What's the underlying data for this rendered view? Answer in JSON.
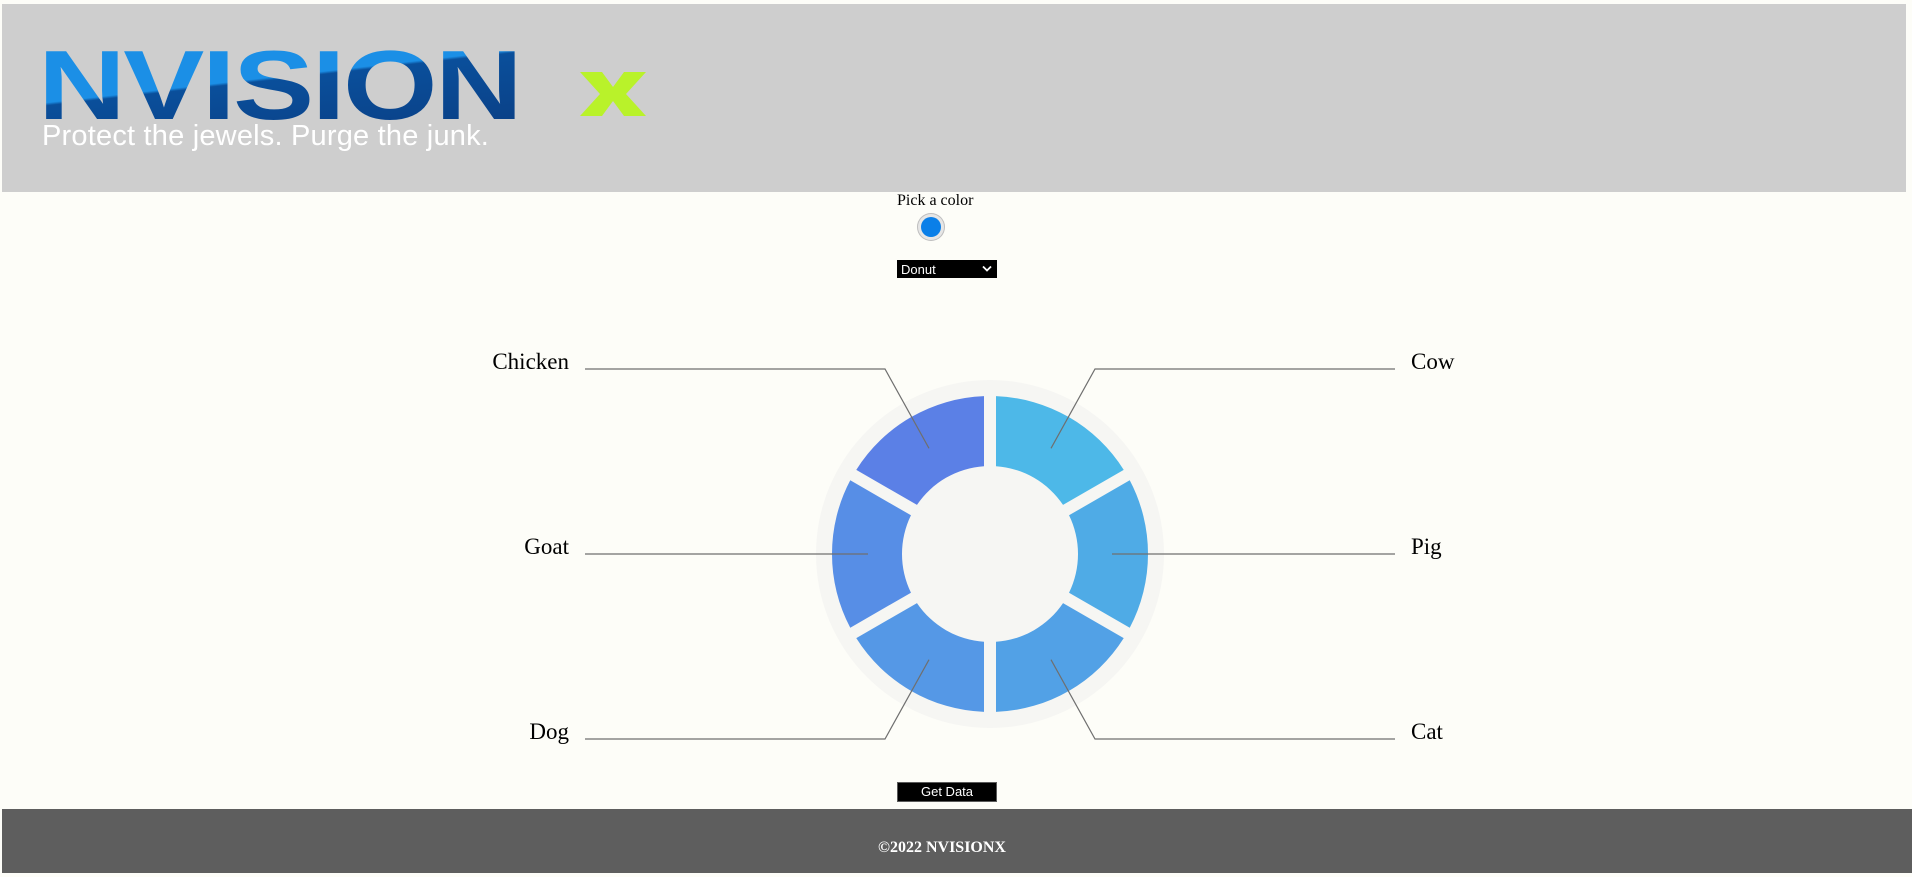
{
  "brand": {
    "logo_text": "NVISION",
    "logo_accent_text": "x",
    "tagline": "Protect the jewels. Purge the junk."
  },
  "controls": {
    "color_label": "Pick a color",
    "color_value": "#0a7fe8",
    "chart_type_selected": "Donut",
    "get_data_label": "Get Data"
  },
  "footer": {
    "copyright": "©2022 NVISIONX"
  },
  "colors": {
    "header_bg": "#cecece",
    "footer_bg": "#5e5e5e",
    "logo_blue": "#1b8fe6",
    "logo_dark_blue": "#0a3f85",
    "logo_accent": "#b9f22a"
  },
  "chart_data": {
    "type": "pie",
    "variant": "donut",
    "title": "",
    "slices": [
      {
        "label": "Cow",
        "value": 1,
        "color": "#4db8e8"
      },
      {
        "label": "Pig",
        "value": 1,
        "color": "#4fabe6"
      },
      {
        "label": "Cat",
        "value": 1,
        "color": "#52a1e6"
      },
      {
        "label": "Dog",
        "value": 1,
        "color": "#5598e6"
      },
      {
        "label": "Goat",
        "value": 1,
        "color": "#578ee6"
      },
      {
        "label": "Chicken",
        "value": 1,
        "color": "#5b80e6"
      }
    ],
    "legend": "none"
  }
}
